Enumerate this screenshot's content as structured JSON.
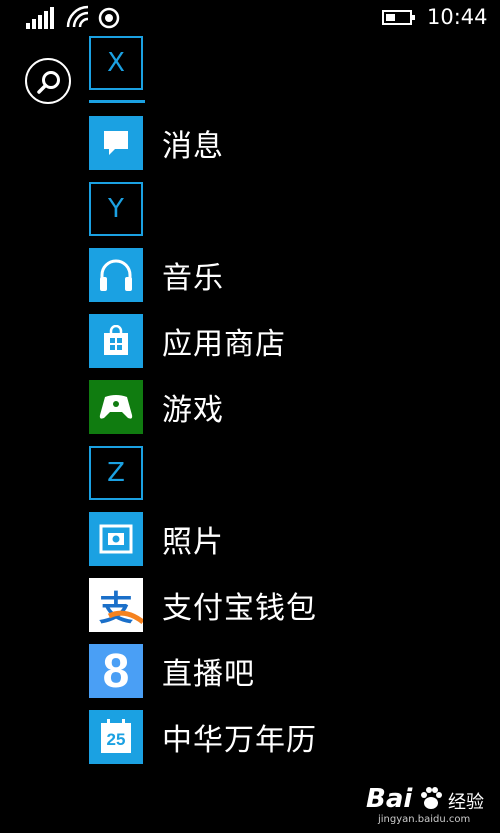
{
  "status_bar": {
    "time": "10:44",
    "icons": [
      "signal-icon",
      "wifi-icon",
      "sync-icon",
      "battery-icon"
    ]
  },
  "search": {
    "icon": "search-icon"
  },
  "groups": [
    {
      "letter": "X",
      "apps": [
        {
          "label": "消息",
          "icon": "chat-bubble-icon",
          "color": "#1ba1e2"
        }
      ]
    },
    {
      "letter": "Y",
      "apps": [
        {
          "label": "音乐",
          "icon": "headphones-icon",
          "color": "#1ba1e2"
        },
        {
          "label": "应用商店",
          "icon": "store-bag-icon",
          "color": "#1ba1e2"
        },
        {
          "label": "游戏",
          "icon": "gamepad-icon",
          "color": "#107c10"
        }
      ]
    },
    {
      "letter": "Z",
      "apps": [
        {
          "label": "照片",
          "icon": "photo-icon",
          "color": "#1ba1e2"
        },
        {
          "label": "支付宝钱包",
          "icon": "alipay-icon",
          "color": "#ffffff"
        },
        {
          "label": "直播吧",
          "icon": "zhiboba-8-icon",
          "color": "#4a9ff5"
        },
        {
          "label": "中华万年历",
          "icon": "calendar-icon",
          "color": "#1ba1e2"
        }
      ]
    }
  ],
  "calendar_day": "25",
  "zhiboba_glyph": "8",
  "alipay_glyph": "支",
  "watermark": {
    "brand": "Bai",
    "brand2": "经验",
    "url": "jingyan.baidu.com"
  }
}
